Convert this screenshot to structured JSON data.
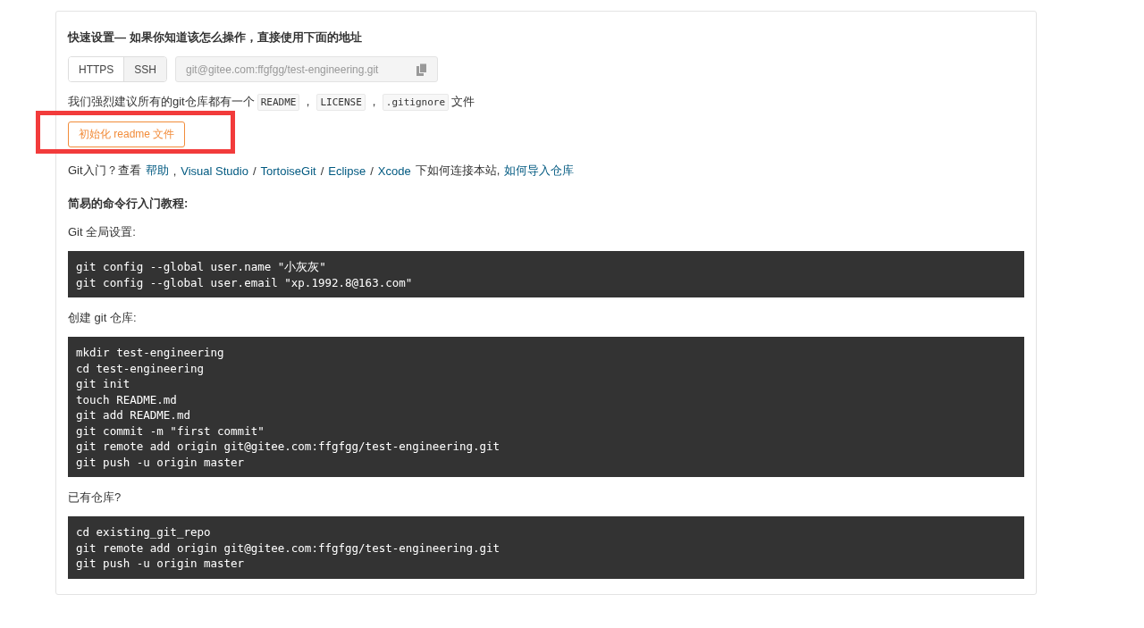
{
  "title": "快速设置— 如果你知道该怎么操作，直接使用下面的地址",
  "protocols": [
    {
      "label": "HTTPS",
      "selected": true
    },
    {
      "label": "SSH",
      "selected": false
    }
  ],
  "clone_url": {
    "value": "git@gitee.com:ffgfgg/test-engineering.git"
  },
  "recommend": [
    {
      "kind": "text",
      "text": "我们强烈建议所有的git仓库都有一个"
    },
    {
      "kind": "code",
      "text": "README"
    },
    {
      "kind": "text",
      "text": "，"
    },
    {
      "kind": "code",
      "text": "LICENSE"
    },
    {
      "kind": "text",
      "text": "，"
    },
    {
      "kind": "code",
      "text": ".gitignore"
    },
    {
      "kind": "text",
      "text": "文件"
    }
  ],
  "init_button": "初始化 readme 文件",
  "help": [
    {
      "kind": "text",
      "text": "Git入门？查看"
    },
    {
      "kind": "link",
      "text": "帮助"
    },
    {
      "kind": "text",
      "text": ","
    },
    {
      "kind": "link",
      "text": "Visual Studio"
    },
    {
      "kind": "text",
      "text": "/"
    },
    {
      "kind": "link",
      "text": "TortoiseGit"
    },
    {
      "kind": "text",
      "text": "/"
    },
    {
      "kind": "link",
      "text": "Eclipse"
    },
    {
      "kind": "text",
      "text": "/"
    },
    {
      "kind": "link",
      "text": "Xcode"
    },
    {
      "kind": "text",
      "text": "下如何连接本站,"
    },
    {
      "kind": "link",
      "text": "如何导入仓库"
    }
  ],
  "tutorial_heading": "简易的命令行入门教程:",
  "sections": [
    {
      "label": "Git 全局设置:",
      "lines": [
        "git config --global user.name \"小灰灰\"",
        "git config --global user.email \"xp.1992.8@163.com\""
      ]
    },
    {
      "label": "创建 git 仓库:",
      "lines": [
        "mkdir test-engineering",
        "cd test-engineering",
        "git init",
        "touch README.md",
        "git add README.md",
        "git commit -m \"first commit\"",
        "git remote add origin git@gitee.com:ffgfgg/test-engineering.git",
        "git push -u origin master"
      ]
    },
    {
      "label": "已有仓库?",
      "lines": [
        "cd existing_git_repo",
        "git remote add origin git@gitee.com:ffgfgg/test-engineering.git",
        "git push -u origin master"
      ]
    }
  ]
}
